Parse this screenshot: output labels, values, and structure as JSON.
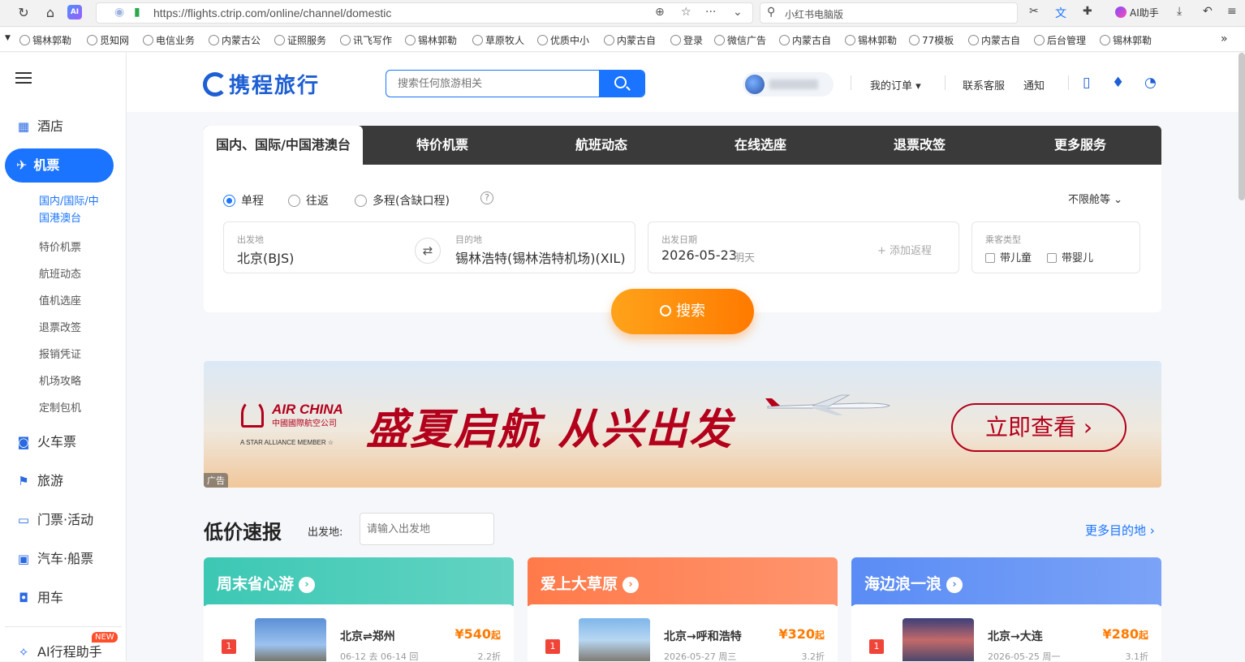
{
  "browser": {
    "url": "https://flights.ctrip.com/online/channel/domestic",
    "search_text": "小红书电脑版",
    "ai_helper": "AI助手",
    "bookmarks": [
      "锡林郭勒",
      "觅知网",
      "电信业务",
      "内蒙古公",
      "证照服务",
      "讯飞写作",
      "锡林郭勒",
      "草原牧人",
      "优质中小",
      "内蒙古自",
      "登录",
      "微信广告",
      "内蒙古自",
      "锡林郭勒",
      "77模板",
      "内蒙古自",
      "后台管理",
      "锡林郭勒"
    ],
    "more": "»"
  },
  "sidebar": {
    "items": [
      {
        "label": "酒店"
      },
      {
        "label": "机票"
      },
      {
        "label": "火车票"
      },
      {
        "label": "旅游"
      },
      {
        "label": "门票·活动"
      },
      {
        "label": "汽车·船票"
      },
      {
        "label": "用车"
      },
      {
        "label": "AI行程助手"
      }
    ],
    "sub_items": [
      "国内/国际/中国港澳台",
      "特价机票",
      "航班动态",
      "值机选座",
      "退票改签",
      "报销凭证",
      "机场攻略",
      "定制包机"
    ],
    "new_badge": "NEW"
  },
  "header": {
    "logo": "携程旅行",
    "search_placeholder": "搜索任何旅游相关",
    "links": [
      "我的订单",
      "联系客服",
      "通知"
    ]
  },
  "panel": {
    "tabs": [
      "国内、国际/中国港澳台",
      "特价机票",
      "航班动态",
      "在线选座",
      "退票改签",
      "更多服务"
    ],
    "trip_types": [
      "单程",
      "往返",
      "多程(含缺口程)"
    ],
    "help": "?",
    "cabin": "不限舱等",
    "origin_label": "出发地",
    "origin": "北京(BJS)",
    "dest_label": "目的地",
    "dest": "锡林浩特(锡林浩特机场)(XIL)",
    "date_label": "出发日期",
    "date": "2026-05-23",
    "date_day": "明天",
    "add_return": "+ 添加返程",
    "pax_label": "乘客类型",
    "child": "带儿童",
    "infant": "带婴儿",
    "search_btn": "搜索"
  },
  "banner": {
    "brand": "AIR CHINA",
    "brand_cn": "中國國際航空公司",
    "alliance": "A STAR ALLIANCE MEMBER ☆",
    "slogan": "盛夏启航  从兴出发",
    "cta": "立即查看  ›",
    "ad": "广告"
  },
  "low_price": {
    "title": "低价速报",
    "from_label": "出发地:",
    "from_placeholder": "请输入出发地",
    "more": "更多目的地 ›",
    "cards": [
      {
        "title": "周末省心游",
        "color": "#3cc8b4",
        "rank": "1",
        "route": "北京⇌郑州",
        "price": "¥540",
        "price_unit": "起",
        "date": "06-12 去 06-14 回",
        "discount": "2.2折"
      },
      {
        "title": "爱上大草原",
        "color": "#ff7a4a",
        "rank": "1",
        "route": "北京→呼和浩特",
        "price": "¥320",
        "price_unit": "起",
        "date": "2026-05-27 周三",
        "discount": "3.2折"
      },
      {
        "title": "海边浪一浪",
        "color": "#5a8cf5",
        "rank": "1",
        "route": "北京→大连",
        "price": "¥280",
        "price_unit": "起",
        "date": "2026-05-25 周一",
        "discount": "3.1折"
      }
    ]
  }
}
